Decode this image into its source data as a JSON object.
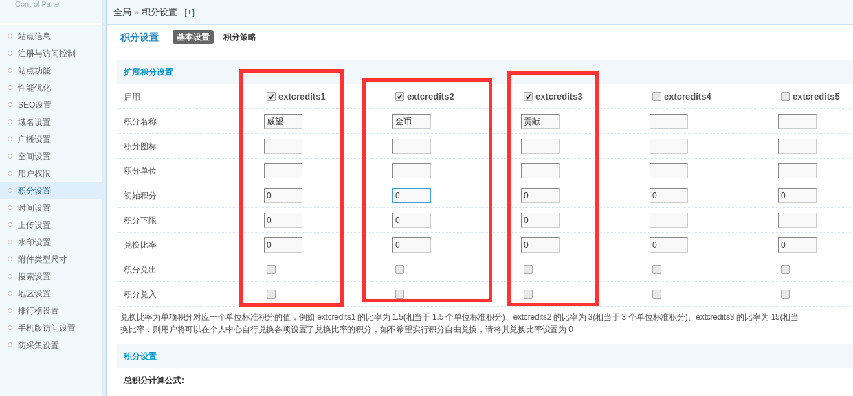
{
  "sidebar": {
    "heading": "Control Panel",
    "items": [
      {
        "label": "站点信息",
        "selected": false
      },
      {
        "label": "注册与访问控制",
        "selected": false
      },
      {
        "label": "站点功能",
        "selected": false
      },
      {
        "label": "性能优化",
        "selected": false
      },
      {
        "label": "SEO设置",
        "selected": false
      },
      {
        "label": "域名设置",
        "selected": false
      },
      {
        "label": "广播设置",
        "selected": false
      },
      {
        "label": "空间设置",
        "selected": false
      },
      {
        "label": "用户权限",
        "selected": false
      },
      {
        "label": "积分设置",
        "selected": true
      },
      {
        "label": "时间设置",
        "selected": false
      },
      {
        "label": "上传设置",
        "selected": false
      },
      {
        "label": "水印设置",
        "selected": false
      },
      {
        "label": "附件类型尺寸",
        "selected": false
      },
      {
        "label": "搜索设置",
        "selected": false
      },
      {
        "label": "地区设置",
        "selected": false
      },
      {
        "label": "排行榜设置",
        "selected": false
      },
      {
        "label": "手机版访问设置",
        "selected": false
      },
      {
        "label": "防采集设置",
        "selected": false
      }
    ]
  },
  "breadcrumb": {
    "items": [
      "全局",
      "积分设置"
    ],
    "separator": "»",
    "add": "[+]"
  },
  "page": {
    "title": "积分设置",
    "tabs": [
      {
        "label": "基本设置",
        "selected": true
      },
      {
        "label": "积分策略",
        "selected": false
      }
    ]
  },
  "section": {
    "title": "扩展积分设置",
    "columns": [
      {
        "label": "extcredits1",
        "checked": true,
        "highlighted": true
      },
      {
        "label": "extcredits2",
        "checked": true,
        "highlighted": true
      },
      {
        "label": "extcredits3",
        "checked": true,
        "highlighted": true
      },
      {
        "label": "extcredits4",
        "checked": false,
        "highlighted": false
      },
      {
        "label": "extcredits5",
        "checked": false,
        "highlighted": false
      }
    ],
    "rows": [
      {
        "label": "启用",
        "kind": "header"
      },
      {
        "label": "积分名称",
        "kind": "input",
        "cells": [
          {
            "value": "威望",
            "focused": false
          },
          {
            "value": "金币",
            "focused": false
          },
          {
            "value": "贡献",
            "focused": false
          },
          {
            "focused": false
          },
          {
            "focused": false
          }
        ]
      },
      {
        "label": "积分图标",
        "kind": "input",
        "cells": [
          {
            "focused": false
          },
          {
            "focused": false
          },
          {
            "focused": false
          },
          {
            "focused": false
          },
          {
            "focused": false
          }
        ]
      },
      {
        "label": "积分单位",
        "kind": "input",
        "cells": [
          {
            "focused": false
          },
          {
            "focused": false
          },
          {
            "focused": false
          },
          {
            "focused": false
          },
          {
            "focused": false
          }
        ]
      },
      {
        "label": "初始积分",
        "kind": "input",
        "cells": [
          {
            "value": "0",
            "focused": false
          },
          {
            "value": "0",
            "focused": true
          },
          {
            "value": "0",
            "focused": false
          },
          {
            "value": "0",
            "focused": false
          },
          {
            "value": "0",
            "focused": false
          }
        ]
      },
      {
        "label": "积分下限",
        "kind": "input",
        "cells": [
          {
            "value": "0",
            "focused": false
          },
          {
            "value": "0",
            "focused": false
          },
          {
            "value": "0",
            "focused": false
          },
          {
            "focused": false
          },
          {
            "focused": false
          }
        ]
      },
      {
        "label": "兑换比率",
        "kind": "input",
        "cells": [
          {
            "value": "0",
            "focused": false
          },
          {
            "value": "0",
            "focused": false
          },
          {
            "value": "0",
            "focused": false
          },
          {
            "value": "0",
            "focused": false
          },
          {
            "value": "0",
            "focused": false
          }
        ]
      },
      {
        "label": "积分兑出",
        "kind": "checkbox",
        "cells": [
          {
            "checked": false
          },
          {
            "checked": false
          },
          {
            "checked": false
          },
          {
            "checked": false
          },
          {
            "checked": false
          }
        ]
      },
      {
        "label": "积分兑入",
        "kind": "checkbox",
        "cells": [
          {
            "checked": false
          },
          {
            "checked": false
          },
          {
            "checked": false
          },
          {
            "checked": false
          },
          {
            "checked": false
          }
        ]
      }
    ],
    "note": [
      "兑换比率为单项积分对应一个单位标准积分的值，例如 extcredits1 的比率为 1.5(相当于 1.5 个单位标准积分)、extcredits2 的比率为 3(相当于 3 个单位标准积分)、extcredits3 的比率为 15(相当",
      "换比率，则用户将可以在个人中心自行兑换各项设置了兑换比率的积分，如不希望实行积分自由兑换，请将其兑换比率设置为 0"
    ]
  },
  "section2": {
    "title": "积分设置",
    "formula_label": "总积分计算公式:"
  }
}
